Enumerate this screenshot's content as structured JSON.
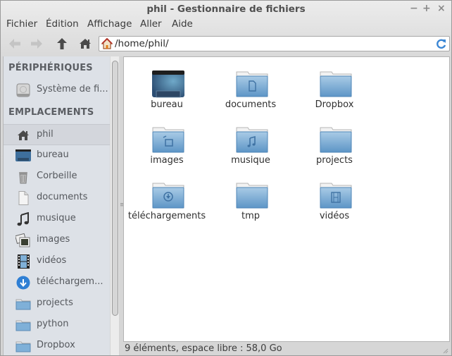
{
  "window": {
    "title": "phil - Gestionnaire de fichiers",
    "controls": {
      "minimize": "−",
      "maximize": "+",
      "close": "×"
    }
  },
  "menubar": {
    "items": [
      "Fichier",
      "Édition",
      "Affichage",
      "Aller",
      "Aide"
    ]
  },
  "toolbar": {
    "back_icon": "arrow-left-icon",
    "forward_icon": "arrow-right-icon",
    "up_icon": "arrow-up-icon",
    "home_icon": "home-icon",
    "address": "/home/phil/",
    "reload_icon": "reload-icon"
  },
  "sidebar": {
    "devices_header": "PÉRIPHÉRIQUES",
    "devices": [
      {
        "label": "Système de fi...",
        "icon": "harddisk-icon"
      }
    ],
    "places_header": "EMPLACEMENTS",
    "places": [
      {
        "label": "phil",
        "icon": "home-icon",
        "selected": true
      },
      {
        "label": "bureau",
        "icon": "desktop-icon"
      },
      {
        "label": "Corbeille",
        "icon": "trash-icon"
      },
      {
        "label": "documents",
        "icon": "document-icon"
      },
      {
        "label": "musique",
        "icon": "music-icon"
      },
      {
        "label": "images",
        "icon": "image-icon"
      },
      {
        "label": "vidéos",
        "icon": "video-icon"
      },
      {
        "label": "téléchargem...",
        "icon": "download-icon"
      },
      {
        "label": "projects",
        "icon": "folder-icon"
      },
      {
        "label": "python",
        "icon": "folder-icon"
      },
      {
        "label": "Dropbox",
        "icon": "folder-icon"
      }
    ]
  },
  "files": [
    {
      "name": "bureau",
      "icon": "desktop-icon"
    },
    {
      "name": "documents",
      "icon": "folder-documents-icon"
    },
    {
      "name": "Dropbox",
      "icon": "folder-icon"
    },
    {
      "name": "images",
      "icon": "folder-pictures-icon"
    },
    {
      "name": "musique",
      "icon": "folder-music-icon"
    },
    {
      "name": "projects",
      "icon": "folder-icon"
    },
    {
      "name": "téléchargements",
      "icon": "folder-download-icon"
    },
    {
      "name": "tmp",
      "icon": "folder-icon"
    },
    {
      "name": "vidéos",
      "icon": "folder-videos-icon"
    }
  ],
  "status": {
    "text": "9 éléments, espace libre : 58,0 Go"
  },
  "colors": {
    "folder_blue": "#6fa3cf",
    "sidebar_bg": "#dde1e7",
    "selection_bg": "#d3d6dc"
  }
}
